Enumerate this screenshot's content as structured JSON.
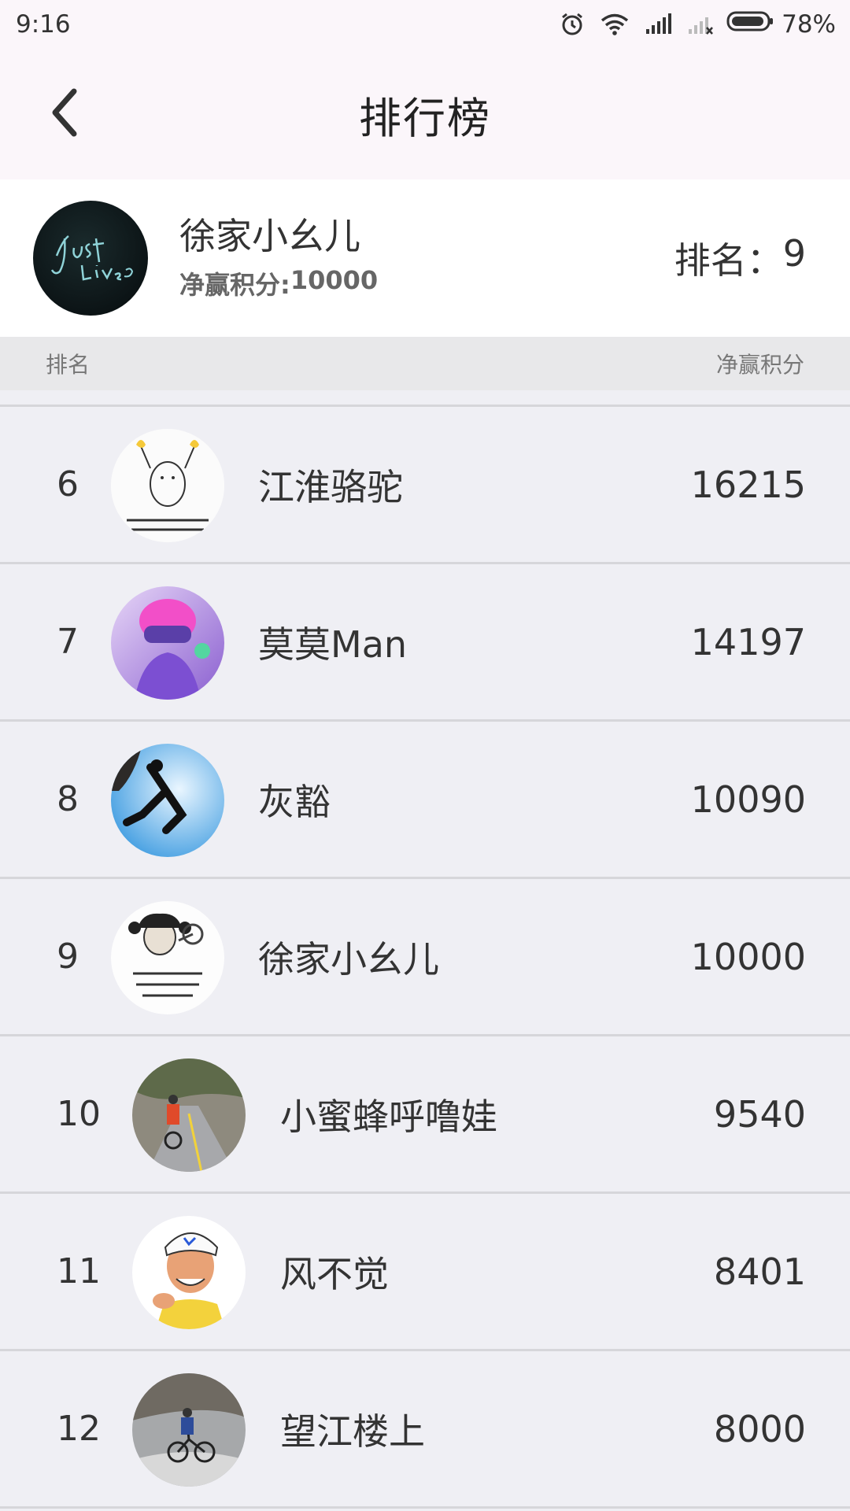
{
  "status_bar": {
    "time": "9:16",
    "battery": "78%",
    "icons": [
      "alarm-icon",
      "wifi-icon",
      "signal-icon",
      "signal-x-icon",
      "battery-icon"
    ]
  },
  "header": {
    "title": "排行榜",
    "back_icon": "chevron-left-icon"
  },
  "my_card": {
    "name": "徐家小幺儿",
    "score_label": "净赢积分:",
    "score_value": "10000",
    "rank_label": "排名：",
    "rank_value": "9"
  },
  "table_head": {
    "rank_label": "排名",
    "score_label": "净赢积分"
  },
  "rows": [
    {
      "rank": "6",
      "name": "江淮骆驼",
      "score": "16215"
    },
    {
      "rank": "7",
      "name": "莫莫Man",
      "score": "14197"
    },
    {
      "rank": "8",
      "name": "灰豁",
      "score": "10090"
    },
    {
      "rank": "9",
      "name": "徐家小幺儿",
      "score": "10000"
    },
    {
      "rank": "10",
      "name": "小蜜蜂呼噜娃",
      "score": "9540"
    },
    {
      "rank": "11",
      "name": "风不觉",
      "score": "8401"
    },
    {
      "rank": "12",
      "name": "望江楼上",
      "score": "8000"
    }
  ],
  "colors": {
    "header_bg": "#fbf6fa",
    "list_bg": "#efeff4",
    "divider": "#d6d6da",
    "table_head_bg": "#e8e8ea"
  }
}
